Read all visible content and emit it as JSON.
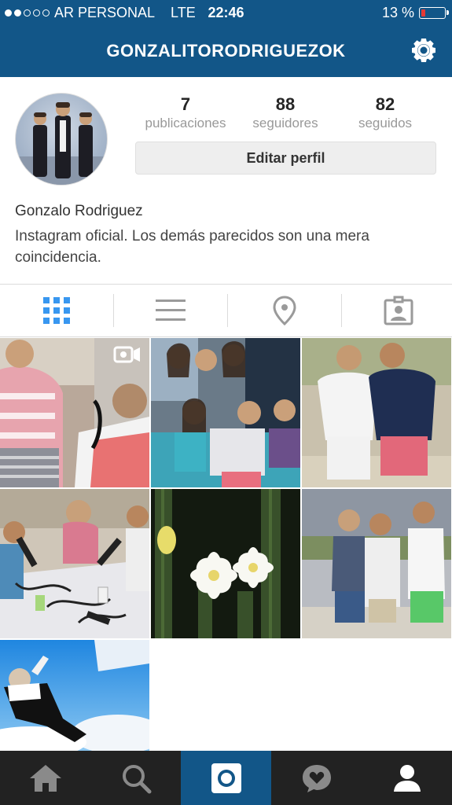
{
  "status_bar": {
    "carrier": "AR PERSONAL",
    "network": "LTE",
    "time": "22:46",
    "battery_level": "13 %",
    "signal_icon": "signal-dots-icon",
    "battery_icon": "battery-icon"
  },
  "header": {
    "username": "GONZALITORODRIGUEZOK",
    "settings_icon": "gear-icon"
  },
  "profile": {
    "stats": [
      {
        "value": "7",
        "label": "publicaciones"
      },
      {
        "value": "88",
        "label": "seguidores"
      },
      {
        "value": "82",
        "label": "seguidos"
      }
    ],
    "edit_button": "Editar perfil",
    "name": "Gonzalo Rodriguez",
    "bio": "Instagram oficial. Los demás parecidos son una mera coincidencia."
  },
  "view_tabs": [
    {
      "name": "grid-view",
      "icon": "grid-icon",
      "active": true
    },
    {
      "name": "list-view",
      "icon": "list-icon",
      "active": false
    },
    {
      "name": "location-view",
      "icon": "location-pin-icon",
      "active": false
    },
    {
      "name": "tagged-view",
      "icon": "tagged-photos-icon",
      "active": false
    }
  ],
  "posts": [
    {
      "type": "video",
      "description": "radio studio interview"
    },
    {
      "type": "photo",
      "description": "group of girls pointing"
    },
    {
      "type": "photo",
      "description": "two men at the beach"
    },
    {
      "type": "photo",
      "description": "radio broadcast table"
    },
    {
      "type": "photo",
      "description": "cactus flower at night"
    },
    {
      "type": "photo",
      "description": "three people on a terrace"
    },
    {
      "type": "photo",
      "description": "man flying in the sky"
    }
  ],
  "bottom_tabs": [
    {
      "icon": "home-icon",
      "active": false
    },
    {
      "icon": "search-icon",
      "active": false
    },
    {
      "icon": "camera-icon",
      "active": true
    },
    {
      "icon": "activity-icon",
      "active": false
    },
    {
      "icon": "profile-icon",
      "active": false
    }
  ],
  "colors": {
    "brand_blue": "#125688",
    "accent_blue": "#3897f0",
    "tabbar_dark": "#222222",
    "battery_low": "#e53935"
  }
}
